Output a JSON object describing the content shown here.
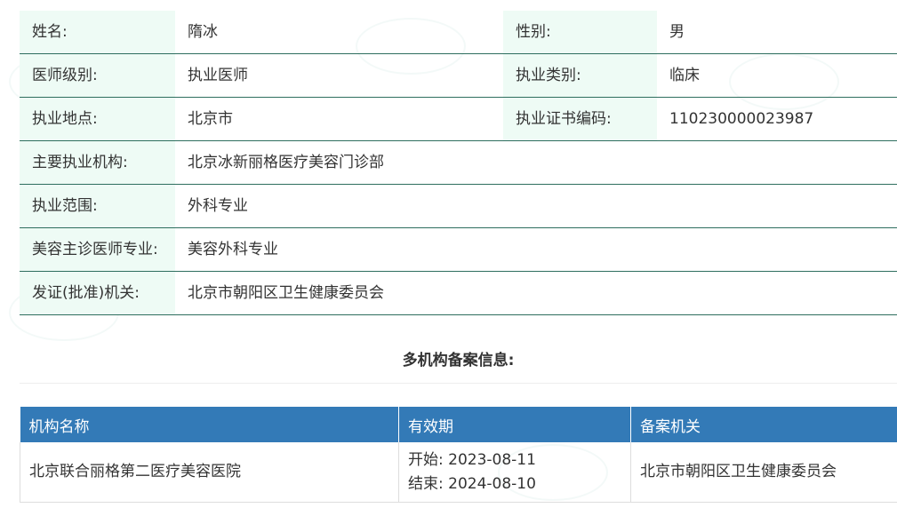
{
  "profile": {
    "rows": [
      {
        "label": "姓名:",
        "value": "隋冰",
        "label2": "性别:",
        "value2": "男"
      },
      {
        "label": "医师级别:",
        "value": "执业医师",
        "label2": "执业类别:",
        "value2": "临床"
      },
      {
        "label": "执业地点:",
        "value": "北京市",
        "label2": "执业证书编码:",
        "value2": "110230000023987"
      },
      {
        "label": "主要执业机构:",
        "value": "北京冰新丽格医疗美容门诊部"
      },
      {
        "label": "执业范围:",
        "value": "外科专业"
      },
      {
        "label": "美容主诊医师专业:",
        "value": "美容外科专业"
      },
      {
        "label": "发证(批准)机关:",
        "value": "北京市朝阳区卫生健康委员会"
      }
    ]
  },
  "multi_org": {
    "title": "多机构备案信息:",
    "headers": [
      "机构名称",
      "有效期",
      "备案机关"
    ],
    "rows": [
      {
        "name": "北京联合丽格第二医疗美容医院",
        "start": "开始:  2023-08-11",
        "end": "结束:  2024-08-10",
        "authority": "北京市朝阳区卫生健康委员会"
      }
    ]
  },
  "colors": {
    "label_bg": "#eefbf5",
    "row_border": "#2e6e5e",
    "header_bg": "#337ab7"
  }
}
